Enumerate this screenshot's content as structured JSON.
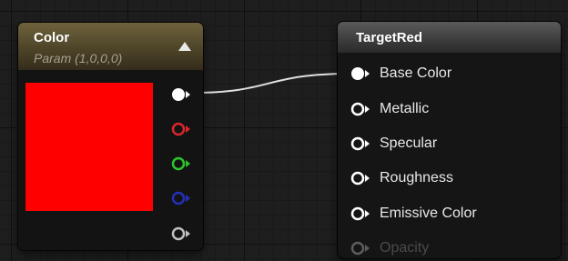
{
  "param_node": {
    "title": "Color",
    "subtitle": "Param (1,0,0,0)",
    "collapse_icon": "triangle-up-icon",
    "swatch_color": "#ff0000",
    "outputs": [
      {
        "name": "rgba",
        "color": "#ffffff",
        "connected": true
      },
      {
        "name": "r",
        "color": "#d9262c",
        "connected": false
      },
      {
        "name": "g",
        "color": "#2cc52c",
        "connected": false
      },
      {
        "name": "b",
        "color": "#2430b8",
        "connected": false
      },
      {
        "name": "a",
        "color": "#bfbfbf",
        "connected": false
      }
    ]
  },
  "material_node": {
    "title": "TargetRed",
    "inputs": [
      {
        "label": "Base Color",
        "connected": true
      },
      {
        "label": "Metallic",
        "connected": false
      },
      {
        "label": "Specular",
        "connected": false
      },
      {
        "label": "Roughness",
        "connected": false
      },
      {
        "label": "Emissive Color",
        "connected": false
      },
      {
        "label": "Opacity",
        "connected": false
      }
    ]
  },
  "wire_color": "#e0e0e0"
}
